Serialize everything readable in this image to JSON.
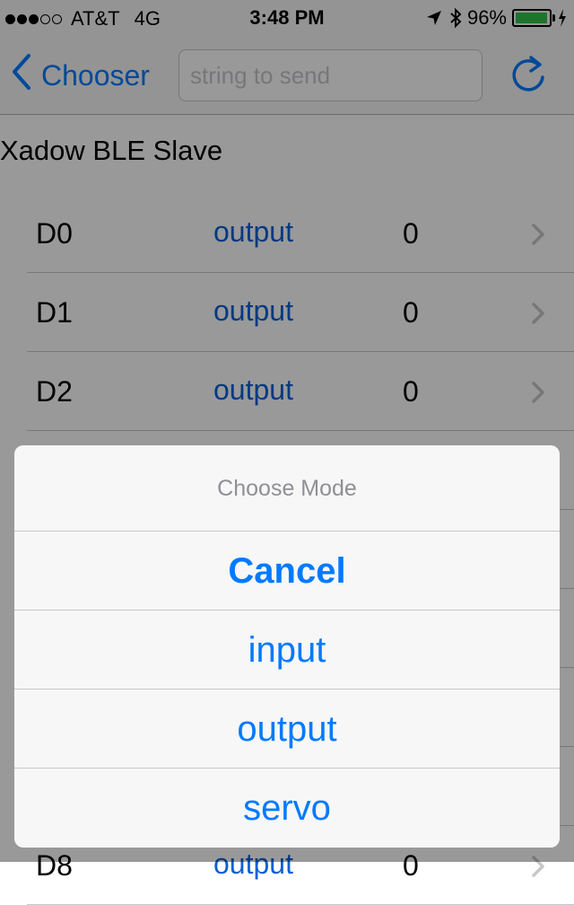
{
  "status_bar": {
    "carrier": "AT&T",
    "network": "4G",
    "time": "3:48 PM",
    "battery_percent": "96%",
    "battery_level": 0.96,
    "signal_bars_filled": 3,
    "signal_bars_total": 5,
    "icons": [
      "location-arrow-icon",
      "bluetooth-icon",
      "battery-icon",
      "charging-bolt-icon"
    ]
  },
  "nav": {
    "back_label": "Chooser",
    "send_placeholder": "string to send",
    "send_value": "",
    "refresh_icon": "refresh-icon"
  },
  "device": {
    "name": "Xadow BLE Slave"
  },
  "pins": [
    {
      "name": "D0",
      "mode": "output",
      "value": "0"
    },
    {
      "name": "D1",
      "mode": "output",
      "value": "0"
    },
    {
      "name": "D2",
      "mode": "output",
      "value": "0"
    },
    {
      "name": "",
      "mode": "",
      "value": ""
    },
    {
      "name": "",
      "mode": "",
      "value": ""
    },
    {
      "name": "",
      "mode": "",
      "value": ""
    },
    {
      "name": "",
      "mode": "",
      "value": ""
    },
    {
      "name": "",
      "mode": "",
      "value": ""
    },
    {
      "name": "D8",
      "mode": "output",
      "value": "0"
    }
  ],
  "action_sheet": {
    "title": "Choose Mode",
    "cancel": "Cancel",
    "options": [
      "input",
      "output",
      "servo"
    ]
  },
  "colors": {
    "accent": "#007aff",
    "mode_text": "#0a60d6",
    "battery_fill": "#35c24a"
  }
}
